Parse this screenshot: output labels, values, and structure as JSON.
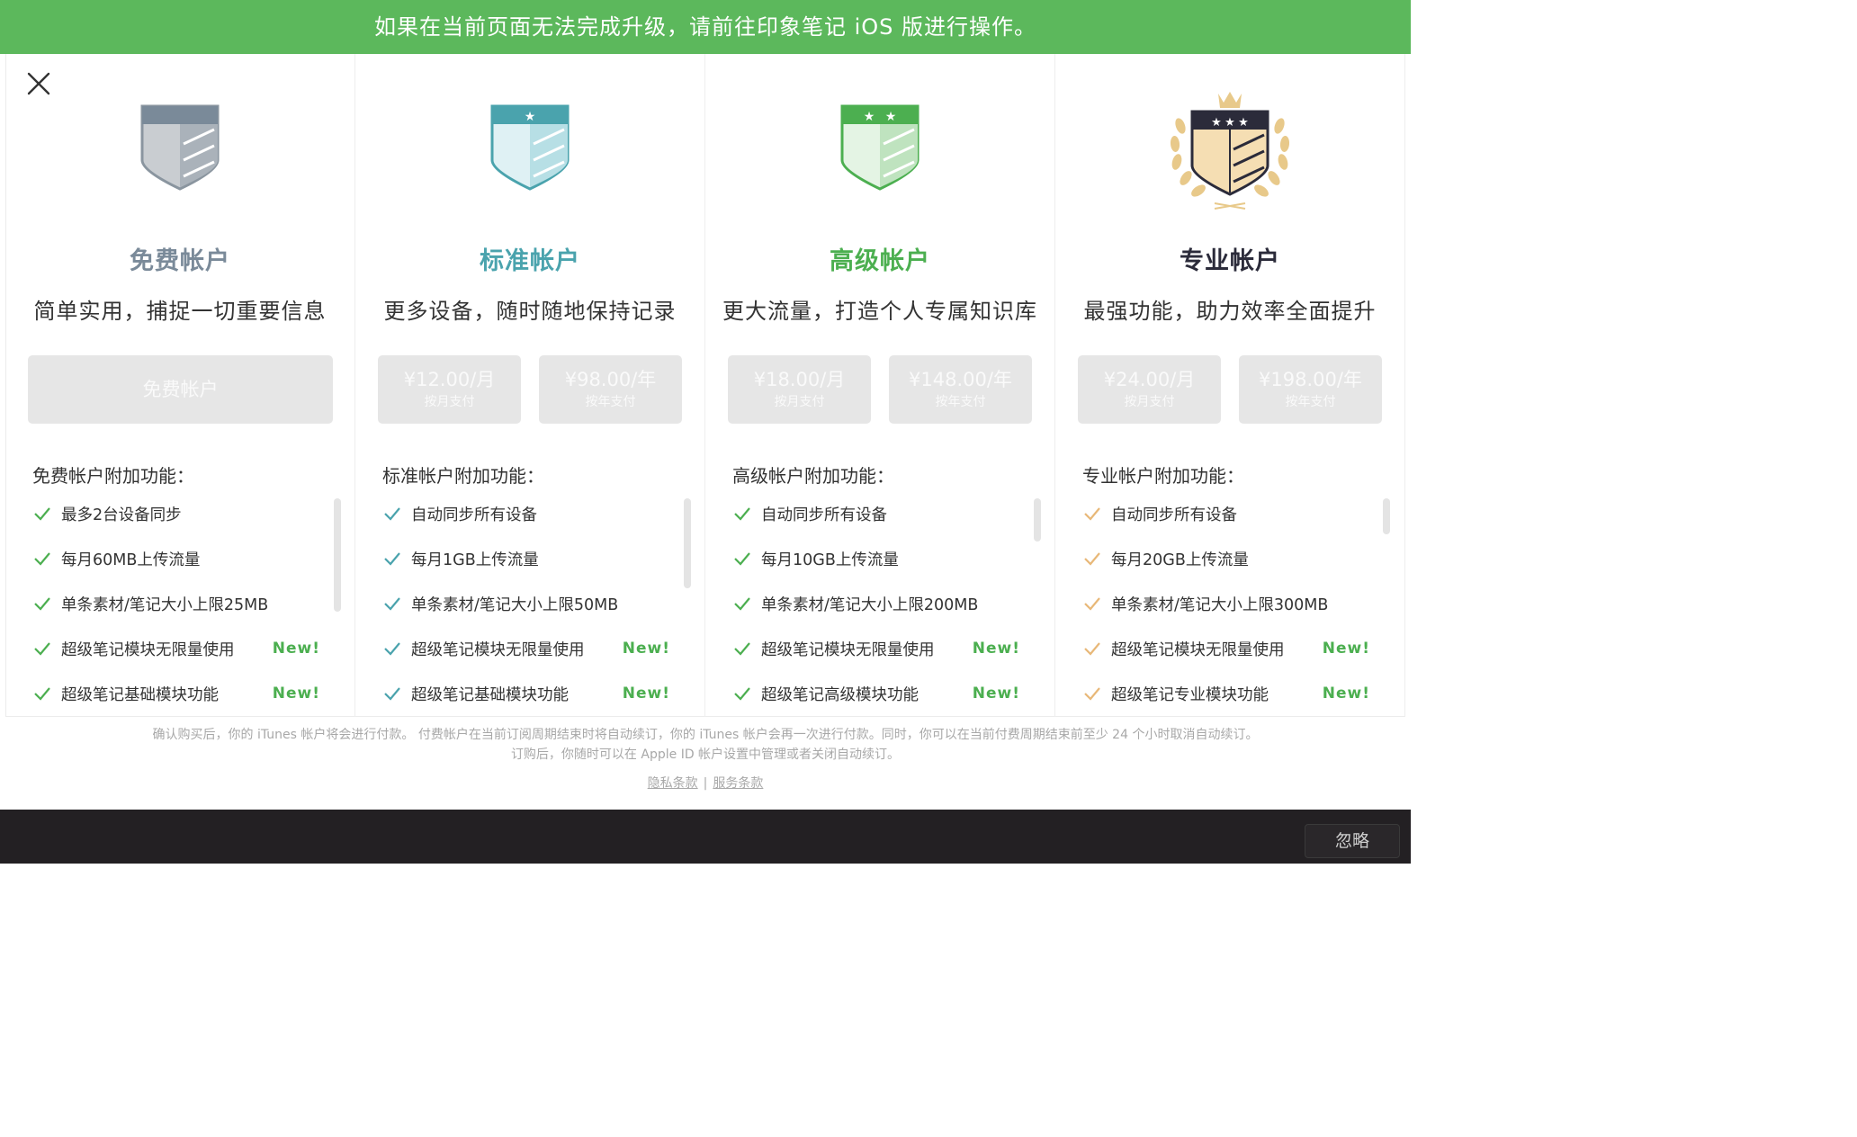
{
  "banner": {
    "text": "如果在当前页面无法完成升级，请前往印象笔记 iOS 版进行操作。"
  },
  "colors": {
    "banner": "#5cb85c",
    "free": "#7a8a99",
    "standard": "#4aa3ad",
    "premium": "#4caf50",
    "professional": "#2b2b3a",
    "check_green": "#4caf50",
    "check_gold": "#e8b878"
  },
  "tiers": [
    {
      "name": "免费帐户",
      "tagline": "简单实用，捕捉一切重要信息",
      "button": "免费帐户",
      "features_title": "免费帐户附加功能：",
      "features": [
        {
          "text": "最多2台设备同步",
          "badge": ""
        },
        {
          "text": "每月60MB上传流量",
          "badge": ""
        },
        {
          "text": "单条素材/笔记大小上限25MB",
          "badge": ""
        },
        {
          "text": "超级笔记模块无限量使用",
          "badge": "New!"
        },
        {
          "text": "超级笔记基础模块功能",
          "badge": "New!"
        }
      ]
    },
    {
      "name": "标准帐户",
      "tagline": "更多设备，随时随地保持记录",
      "monthly": {
        "price": "¥12.00/月",
        "sub": "按月支付"
      },
      "yearly": {
        "price": "¥98.00/年",
        "sub": "按年支付"
      },
      "features_title": "标准帐户附加功能：",
      "features": [
        {
          "text": "自动同步所有设备",
          "badge": ""
        },
        {
          "text": "每月1GB上传流量",
          "badge": ""
        },
        {
          "text": "单条素材/笔记大小上限50MB",
          "badge": ""
        },
        {
          "text": "超级笔记模块无限量使用",
          "badge": "New!"
        },
        {
          "text": "超级笔记基础模块功能",
          "badge": "New!"
        }
      ]
    },
    {
      "name": "高级帐户",
      "tagline": "更大流量，打造个人专属知识库",
      "monthly": {
        "price": "¥18.00/月",
        "sub": "按月支付"
      },
      "yearly": {
        "price": "¥148.00/年",
        "sub": "按年支付"
      },
      "features_title": "高级帐户附加功能：",
      "features": [
        {
          "text": "自动同步所有设备",
          "badge": ""
        },
        {
          "text": "每月10GB上传流量",
          "badge": ""
        },
        {
          "text": "单条素材/笔记大小上限200MB",
          "badge": ""
        },
        {
          "text": "超级笔记模块无限量使用",
          "badge": "New!"
        },
        {
          "text": "超级笔记高级模块功能",
          "badge": "New!"
        }
      ]
    },
    {
      "name": "专业帐户",
      "tagline": "最强功能，助力效率全面提升",
      "monthly": {
        "price": "¥24.00/月",
        "sub": "按月支付"
      },
      "yearly": {
        "price": "¥198.00/年",
        "sub": "按年支付"
      },
      "features_title": "专业帐户附加功能：",
      "features": [
        {
          "text": "自动同步所有设备",
          "badge": ""
        },
        {
          "text": "每月20GB上传流量",
          "badge": ""
        },
        {
          "text": "单条素材/笔记大小上限300MB",
          "badge": ""
        },
        {
          "text": "超级笔记模块无限量使用",
          "badge": "New!"
        },
        {
          "text": "超级笔记专业模块功能",
          "badge": "New!"
        }
      ]
    }
  ],
  "footer": {
    "line1": "确认购买后，你的 iTunes 帐户将会进行付款。 付费帐户在当前订阅周期结束时将自动续订，你的 iTunes 帐户会再一次进行付款。同时，你可以在当前付费周期结束前至少 24 个小时取消自动续订。",
    "line2": "订购后，你随时可以在 Apple ID 帐户设置中管理或者关闭自动续订。",
    "privacy_link": "隐私条款",
    "separator": "|",
    "terms_link": "服务条款"
  },
  "bottom_bar": {
    "ignore_label": "忽略"
  }
}
